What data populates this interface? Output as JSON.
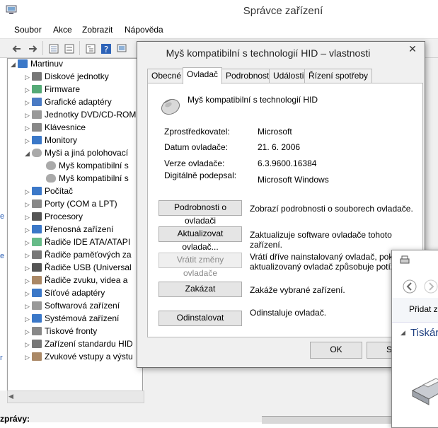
{
  "device_manager": {
    "title": "Správce zařízení",
    "menu": [
      "Soubor",
      "Akce",
      "Zobrazit",
      "Nápověda"
    ],
    "tree": {
      "root": "Martinuv",
      "items": [
        {
          "label": "Diskové jednotky",
          "icon": "disk-icon"
        },
        {
          "label": "Firmware",
          "icon": "chip-icon"
        },
        {
          "label": "Grafické adaptéry",
          "icon": "display-adapter-icon"
        },
        {
          "label": "Jednotky DVD/CD-ROM",
          "icon": "dvd-icon"
        },
        {
          "label": "Klávesnice",
          "icon": "keyboard-icon"
        },
        {
          "label": "Monitory",
          "icon": "monitor-icon"
        },
        {
          "label": "Myši a jiná polohovací",
          "icon": "mouse-icon",
          "expanded": true
        },
        {
          "label": "Myš kompatibilní s",
          "icon": "mouse-icon",
          "child": true
        },
        {
          "label": "Myš kompatibilní s",
          "icon": "mouse-icon",
          "child": true
        },
        {
          "label": "Počítač",
          "icon": "computer-icon"
        },
        {
          "label": "Porty (COM a LPT)",
          "icon": "port-icon"
        },
        {
          "label": "Procesory",
          "icon": "processor-icon"
        },
        {
          "label": "Přenosná zařízení",
          "icon": "portable-device-icon"
        },
        {
          "label": "Řadiče IDE ATA/ATAPI",
          "icon": "ide-controller-icon"
        },
        {
          "label": "Řadiče paměťových za",
          "icon": "storage-controller-icon"
        },
        {
          "label": "Řadiče USB (Universal",
          "icon": "usb-icon"
        },
        {
          "label": "Řadiče zvuku, videa a",
          "icon": "sound-icon"
        },
        {
          "label": "Síťové adaptéry",
          "icon": "network-icon"
        },
        {
          "label": "Softwarová zařízení",
          "icon": "software-device-icon"
        },
        {
          "label": "Systémová zařízení",
          "icon": "system-device-icon"
        },
        {
          "label": "Tiskové fronty",
          "icon": "print-queue-icon"
        },
        {
          "label": "Zařízení standardu HID",
          "icon": "hid-icon"
        },
        {
          "label": "Zvukové vstupy a výstu",
          "icon": "audio-io-icon"
        }
      ]
    },
    "status": "zprávy:"
  },
  "dialog": {
    "title": "Myš kompatibilní s technologií HID – vlastnosti",
    "close": "✕",
    "tabs": [
      "Obecné",
      "Ovladač",
      "Podrobnosti",
      "Události",
      "Řízení spotřeby"
    ],
    "device_name": "Myš kompatibilní s technologií HID",
    "info": [
      {
        "label": "Zprostředkovatel:",
        "value": "Microsoft"
      },
      {
        "label": "Datum ovladače:",
        "value": "21. 6. 2006"
      },
      {
        "label": "Verze ovladače:",
        "value": "6.3.9600.16384"
      },
      {
        "label": "Digitálně podepsal:",
        "value": "Microsoft Windows"
      }
    ],
    "actions": [
      {
        "button": "Podrobnosti o ovladači",
        "desc": "Zobrazí podrobnosti o souborech ovladače.",
        "disabled": false
      },
      {
        "button": "Aktualizovat ovladač...",
        "desc": "Zaktualizuje software ovladače tohoto zařízení.",
        "disabled": false
      },
      {
        "button": "Vrátit změny ovladače",
        "desc": "Vrátí dříve nainstalovaný ovladač, pokud aktualizovaný ovladač způsobuje potíže.",
        "disabled": true
      },
      {
        "button": "Zakázat",
        "desc": "Zakáže vybrané zařízení.",
        "disabled": false
      },
      {
        "button": "Odinstalovat",
        "desc": "Odinstaluje ovladač.",
        "disabled": false
      }
    ],
    "ok": "OK",
    "storno": "Sto"
  },
  "window3": {
    "add_label": "Přidat z",
    "section": "Tiskár"
  }
}
